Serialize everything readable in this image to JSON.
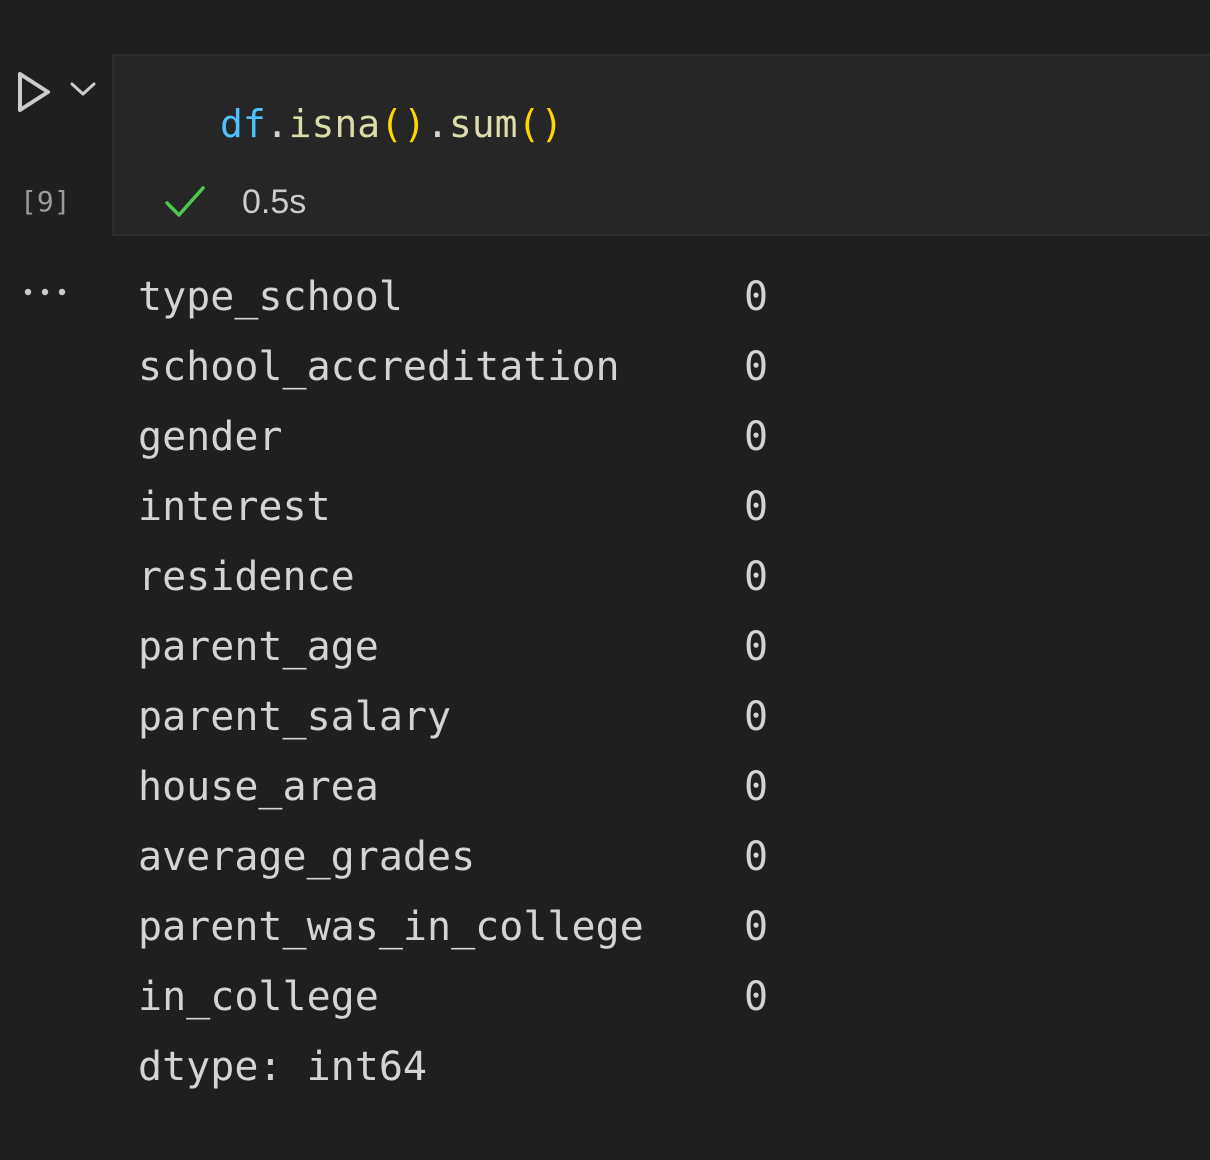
{
  "cell": {
    "execution_count": "[9]",
    "code": {
      "var": "df",
      "dot1": ".",
      "fn1": "isna",
      "open1": "(",
      "close1": ")",
      "dot2": ".",
      "fn2": "sum",
      "open2": "(",
      "close2": ")"
    },
    "status": {
      "icon": "check-icon",
      "duration": "0.5s"
    }
  },
  "output": {
    "rows": [
      {
        "name": "type_school",
        "value": "0"
      },
      {
        "name": "school_accreditation",
        "value": "0"
      },
      {
        "name": "gender",
        "value": "0"
      },
      {
        "name": "interest",
        "value": "0"
      },
      {
        "name": "residence",
        "value": "0"
      },
      {
        "name": "parent_age",
        "value": "0"
      },
      {
        "name": "parent_salary",
        "value": "0"
      },
      {
        "name": "house_area",
        "value": "0"
      },
      {
        "name": "average_grades",
        "value": "0"
      },
      {
        "name": "parent_was_in_college",
        "value": "0"
      },
      {
        "name": "in_college",
        "value": "0"
      }
    ],
    "dtype": "dtype: int64"
  },
  "colors": {
    "background": "#1f1f1f",
    "cell_background": "#262626",
    "variable": "#4fc1ff",
    "function": "#dcdcaa",
    "paren": "#ffd700",
    "success": "#4ec94e"
  }
}
